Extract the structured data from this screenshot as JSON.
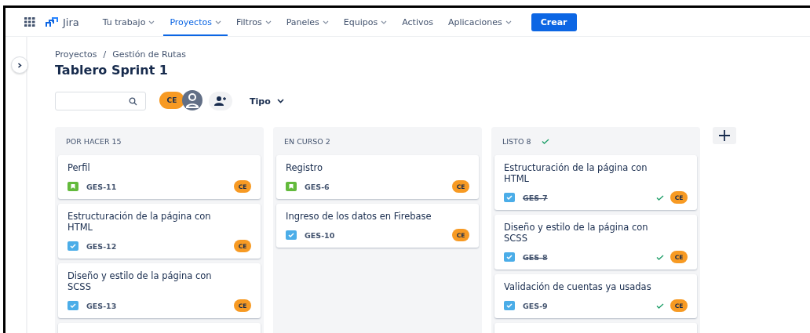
{
  "nav": {
    "logo": "Jira",
    "items": [
      {
        "label": "Tu trabajo",
        "menu": true,
        "selected": false
      },
      {
        "label": "Proyectos",
        "menu": true,
        "selected": true
      },
      {
        "label": "Filtros",
        "menu": true,
        "selected": false
      },
      {
        "label": "Paneles",
        "menu": true,
        "selected": false
      },
      {
        "label": "Equipos",
        "menu": true,
        "selected": false
      },
      {
        "label": "Activos",
        "menu": false,
        "selected": false
      },
      {
        "label": "Aplicaciones",
        "menu": true,
        "selected": false
      }
    ],
    "create_button": "Crear"
  },
  "breadcrumbs": [
    "Proyectos",
    "Gestión de Rutas"
  ],
  "breadcrumb_separator": "/",
  "title": "Tablero Sprint 1",
  "filters": {
    "avatar": "CE",
    "type_filter": "Tipo"
  },
  "columns": [
    {
      "name": "POR HACER 15",
      "done": false,
      "cards": [
        {
          "title": "Perfil",
          "kind": "story",
          "key": "GES-11",
          "resolved": false,
          "assignee": "CE"
        },
        {
          "title": "Estructuración de la página con HTML",
          "kind": "task",
          "key": "GES-12",
          "resolved": false,
          "assignee": "CE"
        },
        {
          "title": "Diseño y estilo de la página con SCSS",
          "kind": "task",
          "key": "GES-13",
          "resolved": false,
          "assignee": "CE"
        },
        {
          "kind": "partial"
        }
      ]
    },
    {
      "name": "EN CURSO 2",
      "done": false,
      "cards": [
        {
          "title": "Registro",
          "kind": "story",
          "key": "GES-6",
          "resolved": false,
          "assignee": "CE"
        },
        {
          "title": "Ingreso de los datos en Firebase",
          "kind": "task",
          "key": "GES-10",
          "resolved": false,
          "assignee": "CE"
        }
      ]
    },
    {
      "name": "LISTO 8",
      "done": true,
      "cards": [
        {
          "title": "Estructuración de la página con HTML",
          "kind": "task",
          "key": "GES-7",
          "resolved": true,
          "assignee": "CE"
        },
        {
          "title": "Diseño y estilo de la página con SCSS",
          "kind": "task",
          "key": "GES-8",
          "resolved": true,
          "assignee": "CE"
        },
        {
          "title": "Validación de cuentas ya usadas",
          "kind": "task",
          "key": "GES-9",
          "resolved": false,
          "assignee": "CE"
        },
        {
          "kind": "partial"
        }
      ]
    }
  ]
}
